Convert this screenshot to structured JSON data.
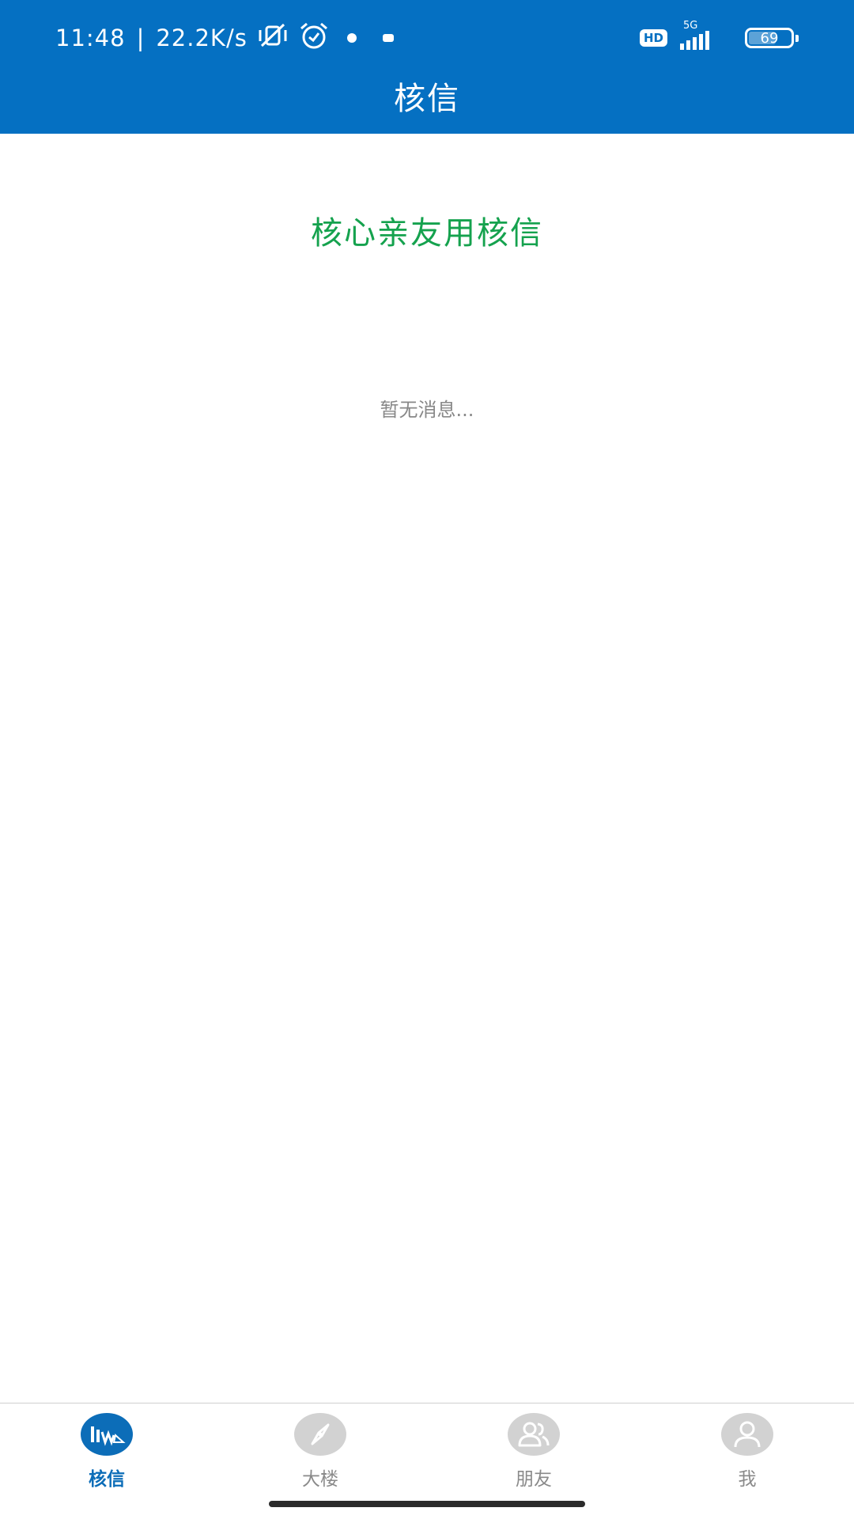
{
  "status_bar": {
    "time": "11:48",
    "separator": "|",
    "net_speed": "22.2K/s",
    "icons": [
      "vibrate-off-icon",
      "alarm-icon",
      "notification-icon",
      "notification-icon"
    ],
    "hd_label": "HD",
    "network_label": "5G",
    "battery_level": "69"
  },
  "header": {
    "title": "核信"
  },
  "content": {
    "slogan": "核心亲友用核信",
    "empty_message": "暂无消息..."
  },
  "tabbar": {
    "active_tab": "核信",
    "tabs": [
      {
        "label": "核信",
        "icon": "hexin-logo-icon"
      },
      {
        "label": "大楼",
        "icon": "compass-icon"
      },
      {
        "label": "朋友",
        "icon": "friends-icon"
      },
      {
        "label": "我",
        "icon": "user-icon"
      }
    ]
  },
  "colors": {
    "primary": "#0570c2",
    "slogan_green": "#15a24e",
    "inactive": "#8a8a8a",
    "inactive_icon_bg": "#d2d2d2"
  }
}
